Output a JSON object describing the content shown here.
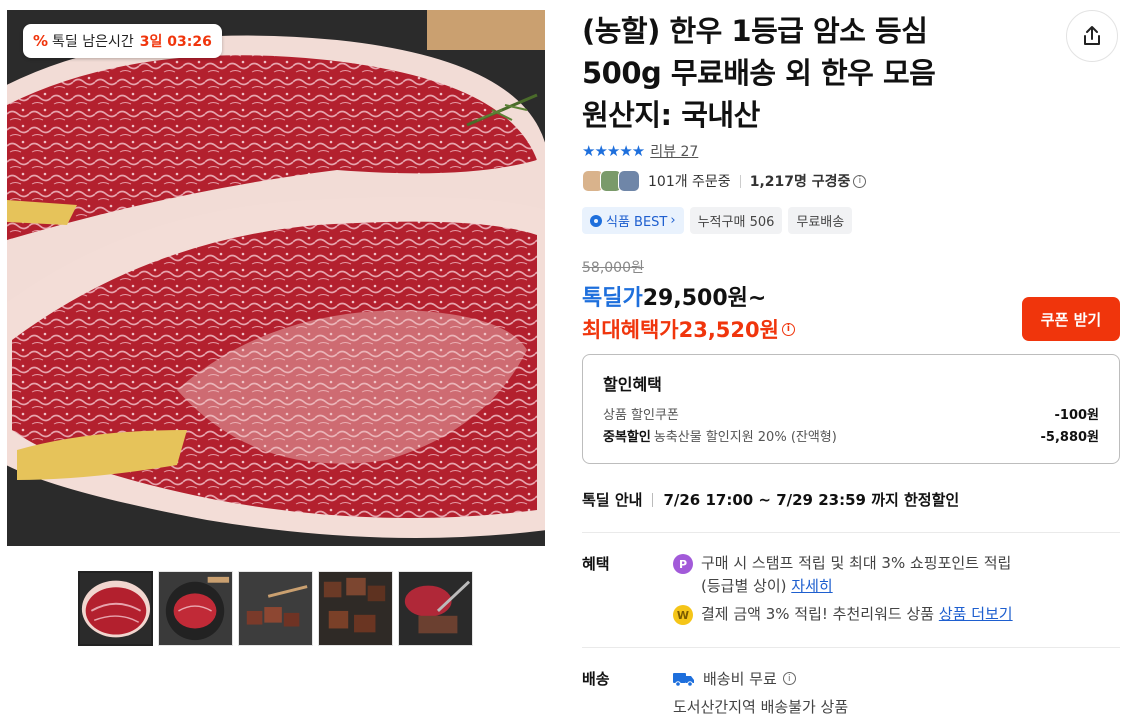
{
  "gallery": {
    "timer_label": "톡딜 남은시간",
    "timer_value": "3일 03:26",
    "thumbnail_count": 5
  },
  "product": {
    "title_lines": [
      "(농할) 한우 1등급 암소 등심",
      "500g 무료배송 외 한우 모음",
      "원산지: 국내산"
    ],
    "stars": "★★★★★",
    "review_text": "리뷰 27",
    "order_count": "101개 주문중",
    "watching_count": "1,217명 구경중",
    "badges": [
      "식품 BEST",
      "누적구매 506",
      "무료배송"
    ]
  },
  "price": {
    "original": "58,000원",
    "deal_label": "톡딜가",
    "deal_price": "29,500원~",
    "max_label": "최대혜택가",
    "max_price": "23,520원",
    "coupon_button": "쿠폰 받기"
  },
  "discount": {
    "title": "할인혜택",
    "row1_label": "상품 할인쿠폰",
    "row1_amount": "-100원",
    "row2_prefix": "중복할인",
    "row2_label": "농축산물 할인지원 20% (잔액형)",
    "row2_amount": "-5,880원"
  },
  "notice": {
    "label": "톡딜 안내",
    "text": "7/26 17:00 ~ 7/29 23:59 까지 한정할인"
  },
  "benefit": {
    "label": "혜택",
    "line1_part1": "구매 시 스탬프 적립 및 최대 3% 쇼핑포인트 적립",
    "line1_part2": "(등급별 상이)",
    "line1_link": "자세히",
    "line2_text": "결제 금액 3% 적립! 추천리워드 상품",
    "line2_link": "상품 더보기",
    "coin_p": "P",
    "coin_w": "W"
  },
  "shipping": {
    "label": "배송",
    "fee_text": "배송비 무료",
    "restriction": "도서산간지역 배송불가 상품"
  },
  "colors": {
    "accent_red": "#f0350c",
    "accent_blue": "#1e6fdc"
  }
}
